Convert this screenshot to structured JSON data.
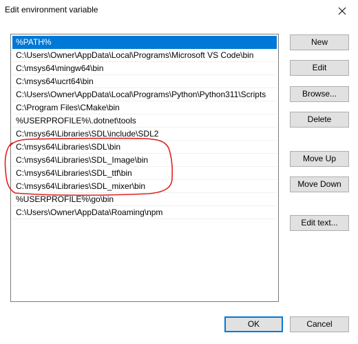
{
  "window": {
    "title": "Edit environment variable"
  },
  "list": {
    "selected_index": 0,
    "items": [
      "%PATH%",
      "C:\\Users\\Owner\\AppData\\Local\\Programs\\Microsoft VS Code\\bin",
      "C:\\msys64\\mingw64\\bin",
      "C:\\msys64\\ucrt64\\bin",
      "C:\\Users\\Owner\\AppData\\Local\\Programs\\Python\\Python311\\Scripts",
      "C:\\Program Files\\CMake\\bin",
      "%USERPROFILE%\\.dotnet\\tools",
      "C:\\msys64\\Libraries\\SDL\\include\\SDL2",
      "C:\\msys64\\Libraries\\SDL\\bin",
      "C:\\msys64\\Libraries\\SDL_Image\\bin",
      "C:\\msys64\\Libraries\\SDL_ttf\\bin",
      "C:\\msys64\\Libraries\\SDL_mixer\\bin",
      "%USERPROFILE%\\go\\bin",
      "C:\\Users\\Owner\\AppData\\Roaming\\npm"
    ]
  },
  "buttons": {
    "new": "New",
    "edit": "Edit",
    "browse": "Browse...",
    "delete": "Delete",
    "move_up": "Move Up",
    "move_down": "Move Down",
    "edit_text": "Edit text...",
    "ok": "OK",
    "cancel": "Cancel"
  },
  "colors": {
    "selection": "#0078d7",
    "annotation": "#e0201e",
    "button_face": "#e1e1e1"
  },
  "icons": {
    "close": "close-icon"
  }
}
